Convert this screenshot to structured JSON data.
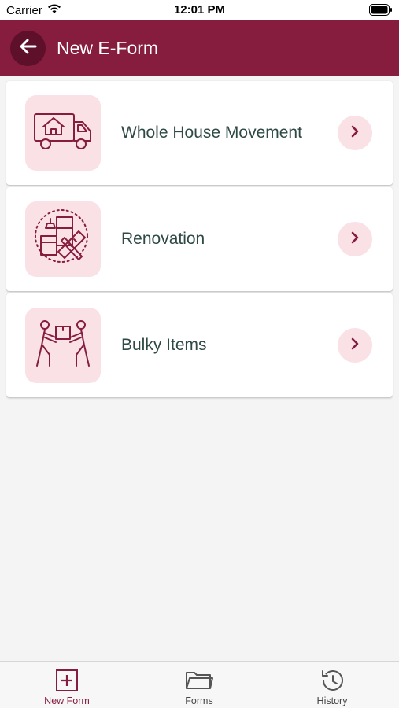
{
  "status_bar": {
    "carrier": "Carrier",
    "time": "12:01 PM"
  },
  "header": {
    "title": "New E-Form"
  },
  "cards": [
    {
      "label": "Whole House Movement",
      "icon": "moving-truck-icon"
    },
    {
      "label": "Renovation",
      "icon": "renovation-tools-icon"
    },
    {
      "label": "Bulky Items",
      "icon": "people-carrying-box-icon"
    }
  ],
  "tabs": [
    {
      "label": "New Form",
      "icon": "plus-square-icon",
      "active": true
    },
    {
      "label": "Forms",
      "icon": "folder-icon",
      "active": false
    },
    {
      "label": "History",
      "icon": "history-icon",
      "active": false
    }
  ],
  "colors": {
    "brand": "#861c3e",
    "brand_dark": "#5e0f2a",
    "icon_bg": "#f9e1e6",
    "label_text": "#2f4a45"
  }
}
